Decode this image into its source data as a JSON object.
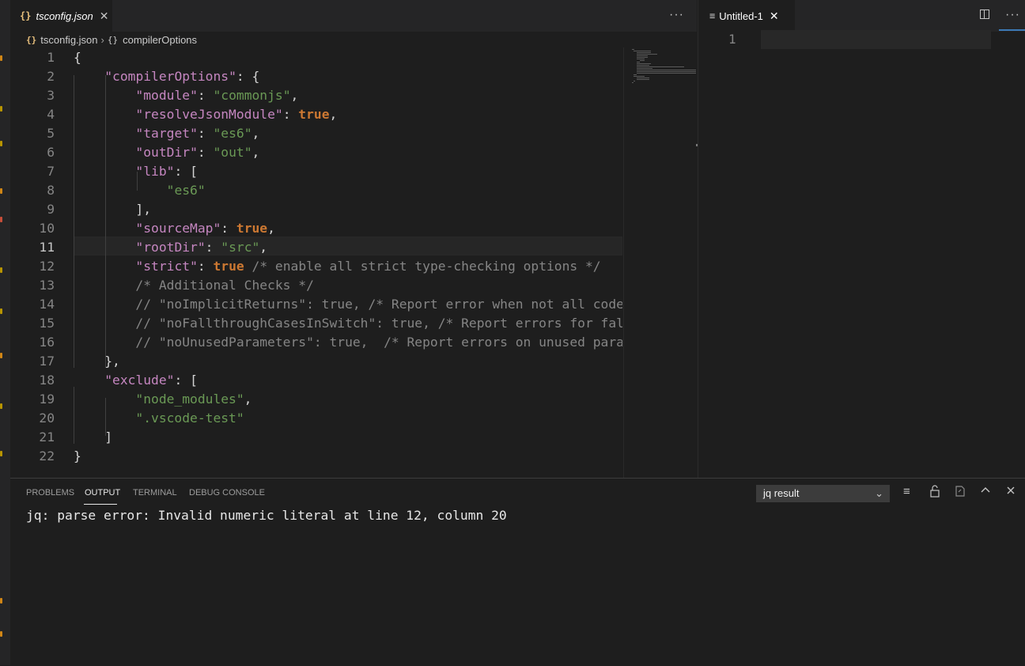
{
  "left_editor": {
    "tab": {
      "icon": "json-braces-icon",
      "label": "tsconfig.json",
      "close": "✕"
    },
    "more_actions": "···",
    "breadcrumb": {
      "file": "tsconfig.json",
      "separator": "›",
      "symbol": "compilerOptions"
    },
    "active_line": 11,
    "lines": [
      {
        "n": "1",
        "html": "{"
      },
      {
        "n": "2",
        "html": "    <span class=\"q\">\"</span><span class=\"key\">compilerOptions</span><span class=\"q\">\"</span>: {"
      },
      {
        "n": "3",
        "html": "        <span class=\"q\">\"</span><span class=\"key\">module</span><span class=\"q\">\"</span>: <span class=\"sg\">\"commonjs\"</span>,"
      },
      {
        "n": "4",
        "html": "        <span class=\"q\">\"</span><span class=\"key\">resolveJsonModule</span><span class=\"q\">\"</span>: <span class=\"b\">true</span>,"
      },
      {
        "n": "5",
        "html": "        <span class=\"q\">\"</span><span class=\"key\">target</span><span class=\"q\">\"</span>: <span class=\"sg\">\"es6\"</span>,"
      },
      {
        "n": "6",
        "html": "        <span class=\"q\">\"</span><span class=\"key\">outDir</span><span class=\"q\">\"</span>: <span class=\"sg\">\"out\"</span>,"
      },
      {
        "n": "7",
        "html": "        <span class=\"q\">\"</span><span class=\"key\">lib</span><span class=\"q\">\"</span>: ["
      },
      {
        "n": "8",
        "html": "            <span class=\"sg\">\"es6\"</span>"
      },
      {
        "n": "9",
        "html": "        ],"
      },
      {
        "n": "10",
        "html": "        <span class=\"q\">\"</span><span class=\"key\">sourceMap</span><span class=\"q\">\"</span>: <span class=\"b\">true</span>,"
      },
      {
        "n": "11",
        "html": "        <span class=\"q\">\"</span><span class=\"key\">rootDir</span><span class=\"q\">\"</span>: <span class=\"sg\">\"src\"</span>,"
      },
      {
        "n": "12",
        "html": "        <span class=\"q\">\"</span><span class=\"key\">strict</span><span class=\"q\">\"</span>: <span class=\"b\">true</span> <span class=\"c\">/* enable all strict type-checking options */</span>"
      },
      {
        "n": "13",
        "html": "        <span class=\"c\">/* Additional Checks */</span>"
      },
      {
        "n": "14",
        "html": "        <span class=\"c\">// \"noImplicitReturns\": true, /* Report error when not all code paths in function return a value. */</span>"
      },
      {
        "n": "15",
        "html": "        <span class=\"c\">// \"noFallthroughCasesInSwitch\": true, /* Report errors for fallthrough cases in switch statement. */</span>"
      },
      {
        "n": "16",
        "html": "        <span class=\"c\">// \"noUnusedParameters\": true,  /* Report errors on unused parameters. */</span>"
      },
      {
        "n": "17",
        "html": "    },"
      },
      {
        "n": "18",
        "html": "    <span class=\"q\">\"</span><span class=\"key\">exclude</span><span class=\"q\">\"</span>: ["
      },
      {
        "n": "19",
        "html": "        <span class=\"sg\">\"node_modules\"</span>,"
      },
      {
        "n": "20",
        "html": "        <span class=\"sg\">\".vscode-test\"</span>"
      },
      {
        "n": "21",
        "html": "    ]"
      },
      {
        "n": "22",
        "html": "}"
      }
    ]
  },
  "right_editor": {
    "tab": {
      "icon": "lines-icon",
      "label": "Untitled-1",
      "close": "✕"
    },
    "split_icon": "split-editor-icon",
    "more_actions": "···",
    "line_number": "1"
  },
  "panel": {
    "tabs": [
      "PROBLEMS",
      "OUTPUT",
      "TERMINAL",
      "DEBUG CONSOLE"
    ],
    "active_tab": "OUTPUT",
    "channel_select": {
      "value": "jq result",
      "chevron": "⌄"
    },
    "actions": [
      "clear-output-icon",
      "lock-scroll-icon",
      "open-log-icon",
      "maximize-panel-icon",
      "close-panel-icon"
    ],
    "output": "jq: parse error: Invalid numeric literal at line 12, column 20"
  }
}
